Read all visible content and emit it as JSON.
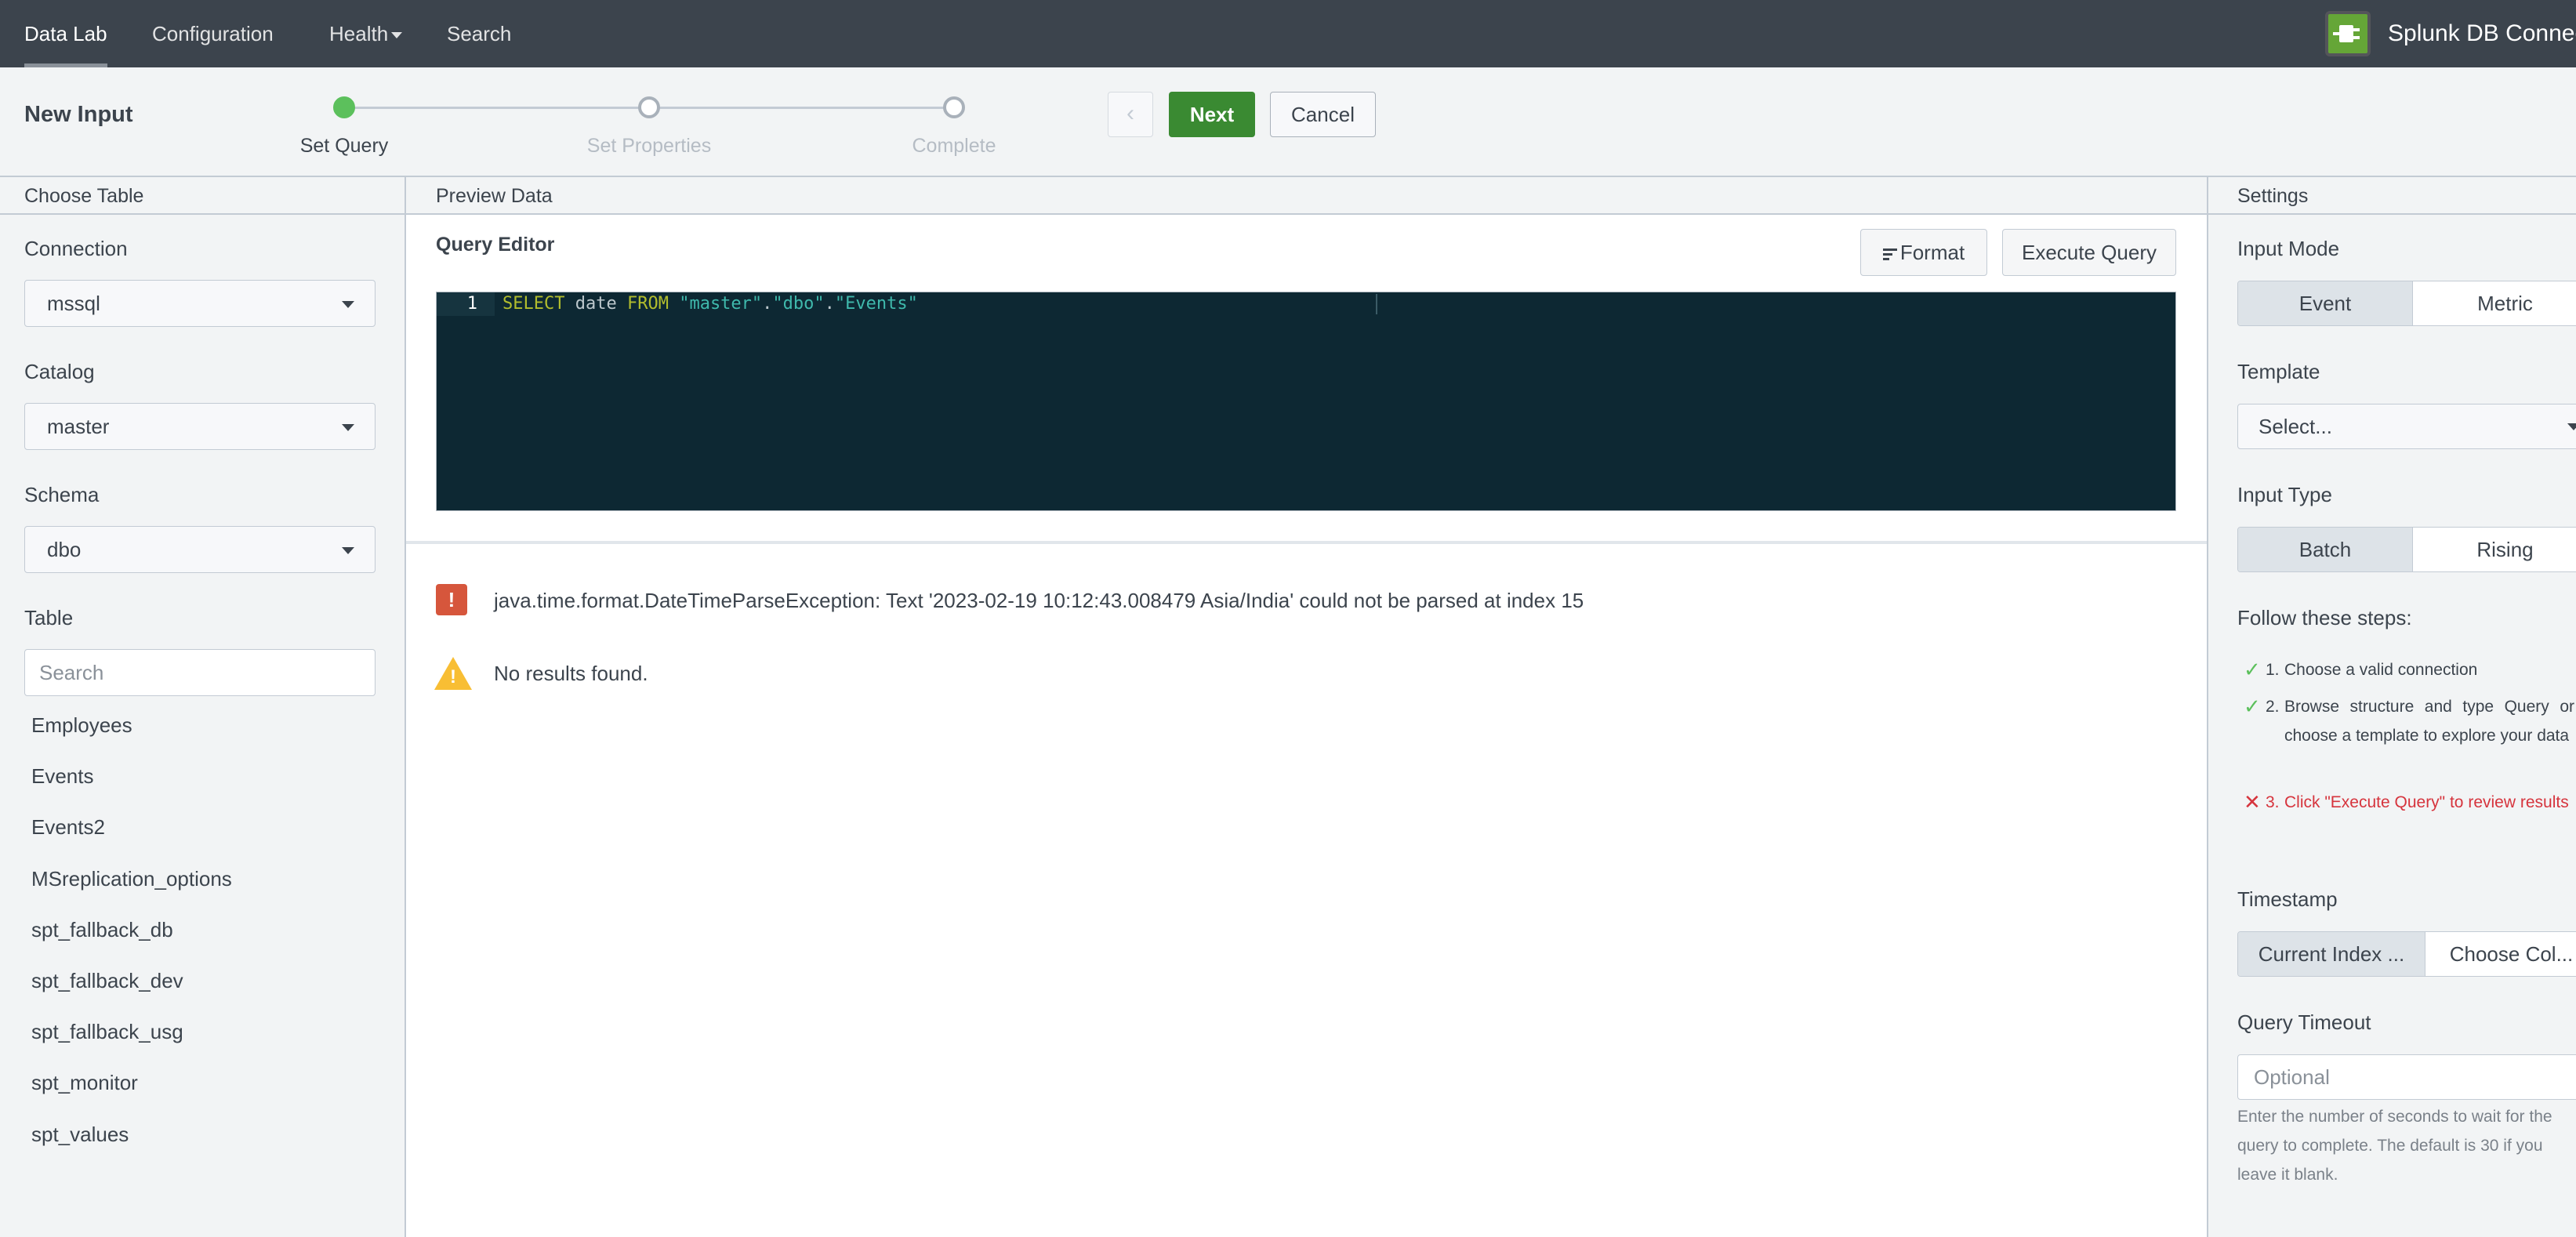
{
  "nav": {
    "items": [
      "Data Lab",
      "Configuration",
      "Health",
      "Search"
    ],
    "brand_title": "Splunk DB Connect"
  },
  "wizard": {
    "page_title": "New Input",
    "steps": [
      "Set Query",
      "Set Properties",
      "Complete"
    ],
    "prev_label": "‹",
    "next_label": "Next",
    "cancel_label": "Cancel"
  },
  "left": {
    "header": "Choose Table",
    "connection_label": "Connection",
    "connection_value": "mssql",
    "catalog_label": "Catalog",
    "catalog_value": "master",
    "schema_label": "Schema",
    "schema_value": "dbo",
    "table_label": "Table",
    "search_placeholder": "Search",
    "tables": [
      "Employees",
      "Events",
      "Events2",
      "MSreplication_options",
      "spt_fallback_db",
      "spt_fallback_dev",
      "spt_fallback_usg",
      "spt_monitor",
      "spt_values"
    ]
  },
  "center": {
    "header": "Preview Data",
    "editor_title": "Query Editor",
    "format_label": "Format",
    "execute_label": "Execute Query",
    "line_number": "1",
    "code": {
      "kw1": "SELECT",
      "ident": " date ",
      "kw2": "FROM",
      "s1": "\"master\"",
      "d1": ".",
      "s2": "\"dbo\"",
      "d2": ".",
      "s3": "\"Events\""
    },
    "error_text": "java.time.format.DateTimeParseException: Text '2023-02-19 10:12:43.008479 Asia/India' could not be parsed at index 15",
    "warning_text": "No results found."
  },
  "right": {
    "header": "Settings",
    "input_mode_label": "Input Mode",
    "input_mode_options": [
      "Event",
      "Metric"
    ],
    "template_label": "Template",
    "template_placeholder": "Select...",
    "input_type_label": "Input Type",
    "input_type_options": [
      "Batch",
      "Rising"
    ],
    "steps_label": "Follow these steps:",
    "steps": [
      {
        "num": "1.",
        "text": "Choose a valid connection",
        "status": "ok"
      },
      {
        "num": "2.",
        "text": "Browse structure and type Query or choose a template to explore your data",
        "status": "ok"
      },
      {
        "num": "3.",
        "text": "Click \"Execute Query\" to review results",
        "status": "error"
      }
    ],
    "timestamp_label": "Timestamp",
    "timestamp_options": [
      "Current Index ...",
      "Choose Col..."
    ],
    "timeout_label": "Query Timeout",
    "timeout_placeholder": "Optional",
    "timeout_help": "Enter the number of seconds to wait for the query to complete. The default is 30 if you leave it blank."
  }
}
